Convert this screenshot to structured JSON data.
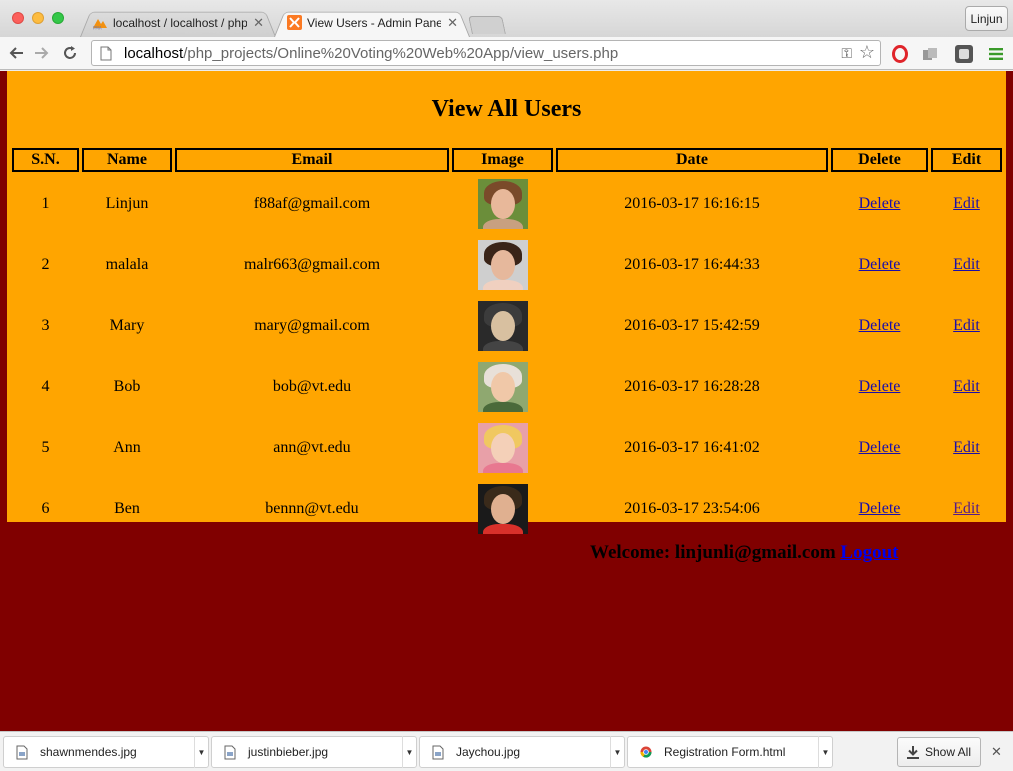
{
  "browser": {
    "tabs": [
      {
        "title": "localhost / localhost / php",
        "active": false
      },
      {
        "title": "View Users - Admin Panel",
        "active": true
      }
    ],
    "profile_name": "Linjun",
    "url_host": "localhost",
    "url_path": "/php_projects/Online%20Voting%20Web%20App/view_users.php"
  },
  "page": {
    "title": "View All Users",
    "columns": [
      "S.N.",
      "Name",
      "Email",
      "Image",
      "Date",
      "Delete",
      "Edit"
    ],
    "rows": [
      {
        "sn": "1",
        "name": "Linjun",
        "email": "f88af@gmail.com",
        "date": "2016-03-17 16:16:15",
        "delete": "Delete",
        "edit": "Edit",
        "avatar": {
          "bg": "#6b8e3a",
          "hair": "#7a4a2a",
          "face": "#e8b89a",
          "body": "#c8a080"
        }
      },
      {
        "sn": "2",
        "name": "malala",
        "email": "malr663@gmail.com",
        "date": "2016-03-17 16:44:33",
        "delete": "Delete",
        "edit": "Edit",
        "avatar": {
          "bg": "#cfcfcf",
          "hair": "#3a2418",
          "face": "#e6b89c",
          "body": "#f0d0c0"
        }
      },
      {
        "sn": "3",
        "name": "Mary",
        "email": "mary@gmail.com",
        "date": "2016-03-17 15:42:59",
        "delete": "Delete",
        "edit": "Edit",
        "avatar": {
          "bg": "#2a2a2a",
          "hair": "#3c3c3c",
          "face": "#d8c0a0",
          "body": "#444444"
        }
      },
      {
        "sn": "4",
        "name": "Bob",
        "email": "bob@vt.edu",
        "date": "2016-03-17 16:28:28",
        "delete": "Delete",
        "edit": "Edit",
        "avatar": {
          "bg": "#8fa870",
          "hair": "#e8e0d8",
          "face": "#f0c8a8",
          "body": "#4a6a3a"
        }
      },
      {
        "sn": "5",
        "name": "Ann",
        "email": "ann@vt.edu",
        "date": "2016-03-17 16:41:02",
        "delete": "Delete",
        "edit": "Edit",
        "avatar": {
          "bg": "#e8a0a8",
          "hair": "#f0c860",
          "face": "#f4d0b8",
          "body": "#e87890"
        }
      },
      {
        "sn": "6",
        "name": "Ben",
        "email": "bennn@vt.edu",
        "date": "2016-03-17 23:54:06",
        "delete": "Delete",
        "edit": "Edit",
        "avatar": {
          "bg": "#1a1a1a",
          "hair": "#3a2a1a",
          "face": "#e0b090",
          "body": "#d8302a"
        }
      }
    ],
    "welcome_text": "Welcome: linjunli@gmail.com",
    "logout_label": "Logout"
  },
  "downloads": [
    {
      "name": "shawnmendes.jpg",
      "icon": "file-icon"
    },
    {
      "name": "justinbieber.jpg",
      "icon": "file-icon"
    },
    {
      "name": "Jaychou.jpg",
      "icon": "file-icon"
    },
    {
      "name": "Registration Form.html",
      "icon": "chrome-icon"
    }
  ],
  "show_all_label": "Show All",
  "colors": {
    "page_bg": "#800000",
    "panel_bg": "#ffa500",
    "link": "#1a0dab"
  }
}
